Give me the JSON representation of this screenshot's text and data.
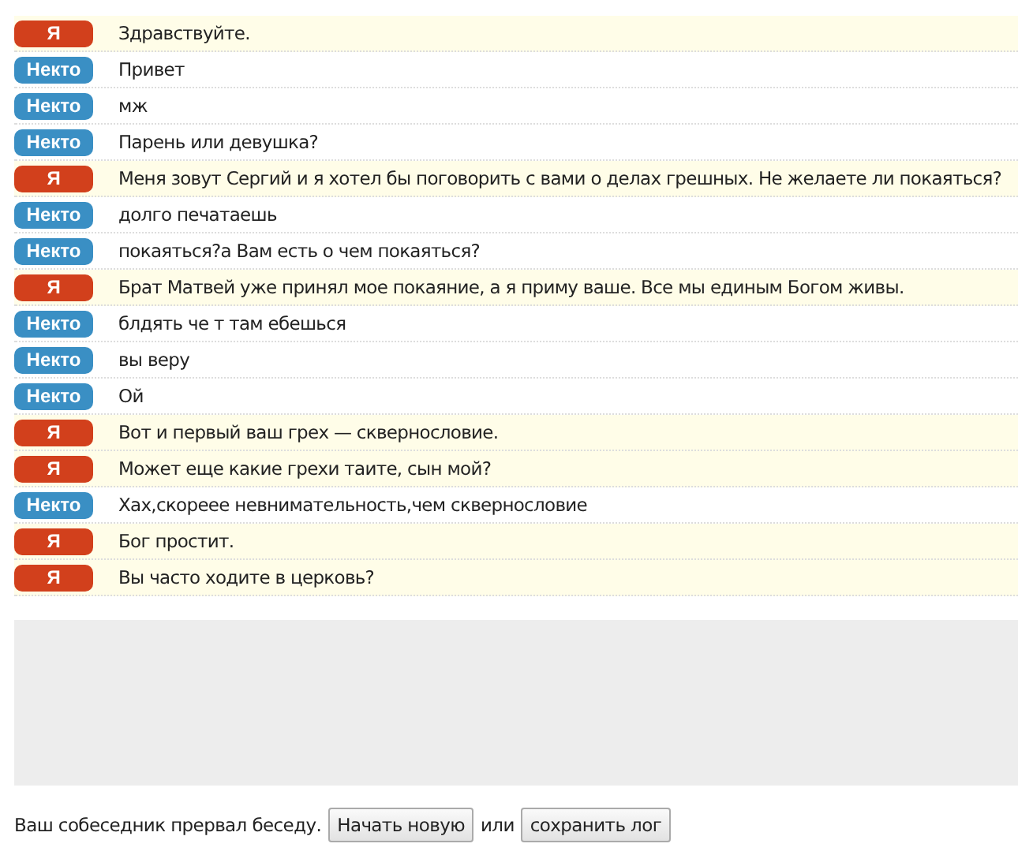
{
  "messages": [
    {
      "kind": "self",
      "sender": "Я",
      "text": "Здравствуйте."
    },
    {
      "kind": "stranger",
      "sender": "Некто",
      "text": "Привет"
    },
    {
      "kind": "stranger",
      "sender": "Некто",
      "text": "мж"
    },
    {
      "kind": "stranger",
      "sender": "Некто",
      "text": "Парень или девушка?"
    },
    {
      "kind": "self",
      "sender": "Я",
      "text": "Меня зовут Сергий и я хотел бы поговорить с вами о делах грешных. Не желаете ли покаяться?"
    },
    {
      "kind": "stranger",
      "sender": "Некто",
      "text": "долго печатаешь"
    },
    {
      "kind": "stranger",
      "sender": "Некто",
      "text": "покаяться?а Вам есть о чем покаяться?"
    },
    {
      "kind": "self",
      "sender": "Я",
      "text": "Брат Матвей уже принял мое покаяние, а я приму ваше. Все мы единым Богом живы."
    },
    {
      "kind": "stranger",
      "sender": "Некто",
      "text": "блдять че т там ебешься"
    },
    {
      "kind": "stranger",
      "sender": "Некто",
      "text": "вы веру"
    },
    {
      "kind": "stranger",
      "sender": "Некто",
      "text": "Ой"
    },
    {
      "kind": "self",
      "sender": "Я",
      "text": "Вот и первый ваш грех — сквернословие."
    },
    {
      "kind": "self",
      "sender": "Я",
      "text": "Может еще какие грехи таите, сын мой?"
    },
    {
      "kind": "stranger",
      "sender": "Некто",
      "text": "Хах,скореее невнимательность,чем сквернословие"
    },
    {
      "kind": "self",
      "sender": "Я",
      "text": "Бог простит."
    },
    {
      "kind": "self",
      "sender": "Я",
      "text": "Вы часто ходите в церковь?"
    }
  ],
  "footer": {
    "status": "Ваш собеседник прервал беседу.",
    "buttons": [
      "Начать новую",
      "сохранить лог"
    ],
    "separator": "или"
  }
}
